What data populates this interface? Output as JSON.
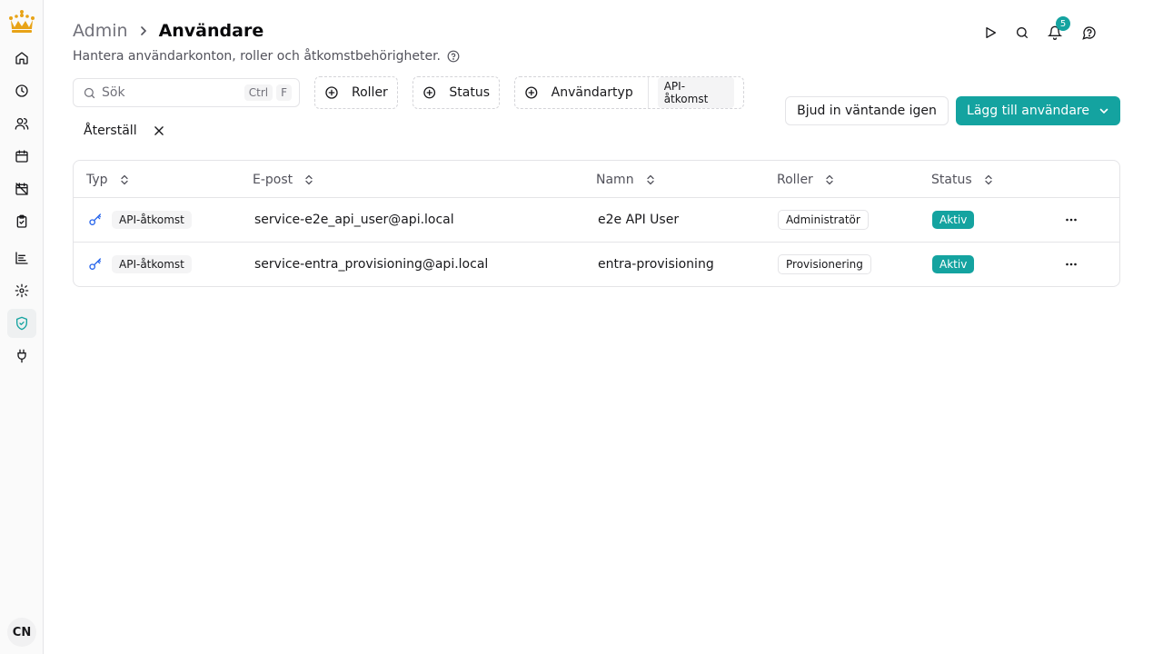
{
  "sidebar": {
    "logo": "crown-logo",
    "items": [
      {
        "name": "home-icon"
      },
      {
        "name": "clock-icon"
      },
      {
        "name": "users-icon"
      },
      {
        "name": "calendar-icon"
      },
      {
        "name": "calendar-off-icon"
      },
      {
        "name": "clipboard-check-icon"
      },
      {
        "name": "chart-icon"
      },
      {
        "name": "settings-icon"
      },
      {
        "name": "shield-check-icon",
        "active": true
      },
      {
        "name": "plug-icon"
      }
    ],
    "avatar_initials": "CN"
  },
  "header": {
    "breadcrumb_root": "Admin",
    "breadcrumb_current": "Användare",
    "subtitle": "Hantera användarkonton, roller och åtkomstbehörigheter.",
    "notification_count": "5"
  },
  "toolbar": {
    "search_placeholder": "Sök",
    "shortcut_ctrl": "Ctrl",
    "shortcut_key": "F",
    "filter_roles": "Roller",
    "filter_status": "Status",
    "filter_user_type": "Användartyp",
    "filter_user_type_selected": "API-åtkomst",
    "reset": "Återställ",
    "reinvite": "Bjud in väntande igen",
    "add_user": "Lägg till användare"
  },
  "table": {
    "columns": [
      "Typ",
      "E-post",
      "Namn",
      "Roller",
      "Status"
    ],
    "rows": [
      {
        "type": "API-åtkomst",
        "email": "service-e2e_api_user@api.local",
        "name": "e2e API User",
        "role": "Administratör",
        "status": "Aktiv"
      },
      {
        "type": "API-åtkomst",
        "email": "service-entra_provisioning@api.local",
        "name": "entra-provisioning",
        "role": "Provisionering",
        "status": "Aktiv"
      }
    ]
  },
  "colors": {
    "accent": "#14a3a0",
    "key_icon": "#2563eb",
    "logo": "#e8a317"
  }
}
